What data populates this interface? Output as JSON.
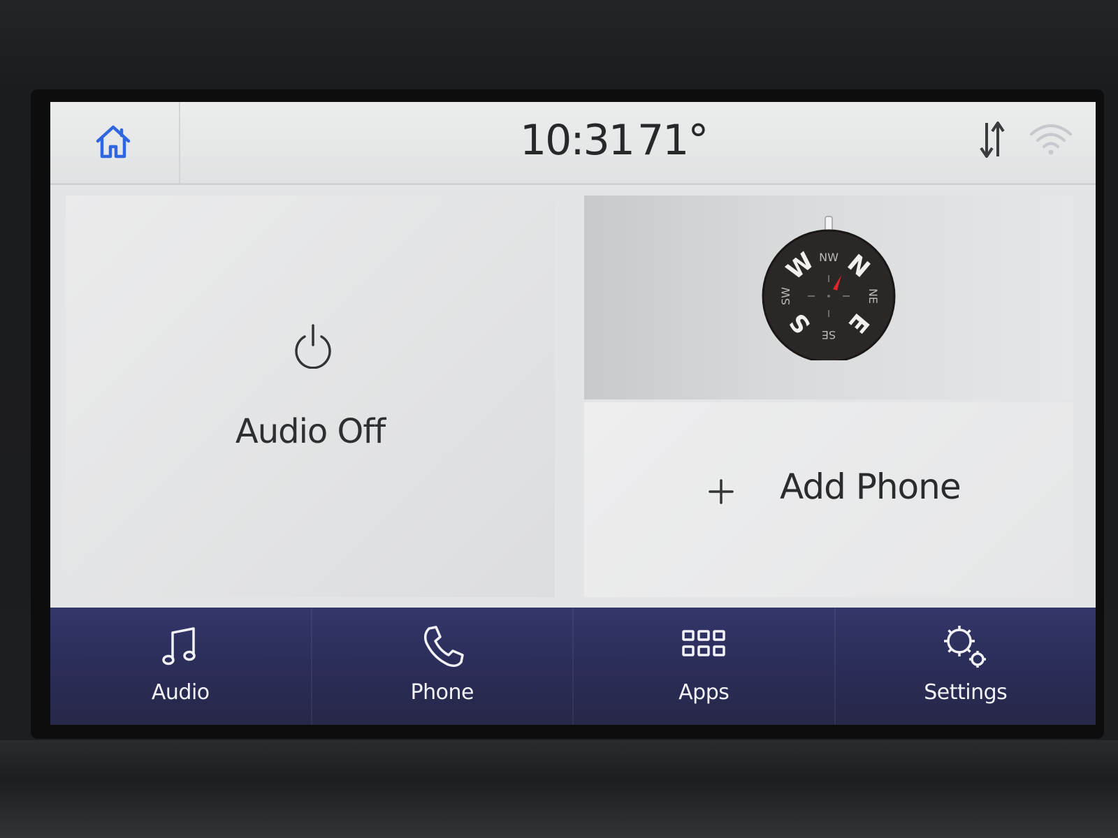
{
  "status_bar": {
    "time": "10:31",
    "temperature": "71°",
    "icons": [
      "home-icon",
      "data-transfer-icon",
      "wifi-icon"
    ]
  },
  "audio_tile": {
    "label": "Audio Off",
    "icon": "power-icon"
  },
  "compass": {
    "labels": {
      "n": "N",
      "nw": "NW",
      "w": "W",
      "sw": "SW",
      "s": "S",
      "se": "SE",
      "e": "E",
      "ne": "NE"
    },
    "needle_color": "#e2262a"
  },
  "phone_tile": {
    "label": "Add Phone",
    "icon": "plus-icon"
  },
  "nav": {
    "audio": "Audio",
    "phone": "Phone",
    "apps": "Apps",
    "settings": "Settings"
  },
  "colors": {
    "accent": "#2f66e0",
    "nav_bg": "#2b2e5e",
    "screen_bg": "#e4e5e6"
  }
}
